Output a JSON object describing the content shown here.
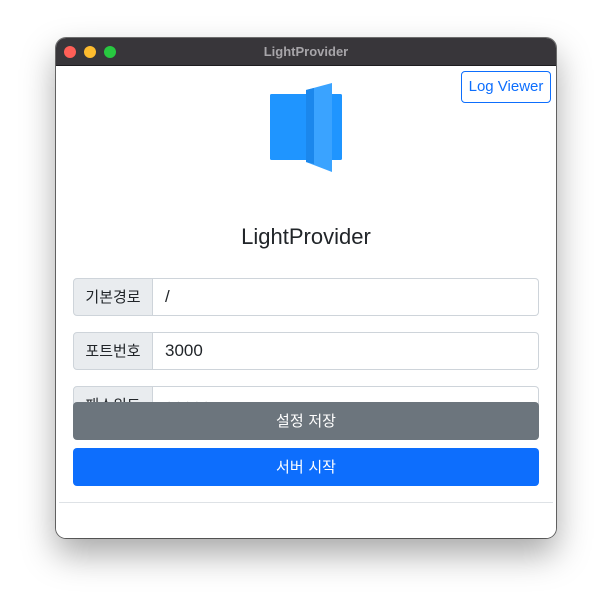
{
  "window": {
    "title": "LightProvider"
  },
  "header": {
    "log_viewer_label": "Log Viewer",
    "app_name": "LightProvider",
    "logo_icon": "open-book-icon",
    "logo_color": "#1f95ff"
  },
  "form": {
    "base_path": {
      "label": "기본경로",
      "value": "/"
    },
    "port": {
      "label": "포트번호",
      "value": "3000"
    },
    "password": {
      "label": "패스워드",
      "value": "•••••"
    }
  },
  "actions": {
    "save_label": "설정 저장",
    "start_label": "서버 시작",
    "save_color": "#6c757d",
    "start_color": "#0d6efd"
  }
}
